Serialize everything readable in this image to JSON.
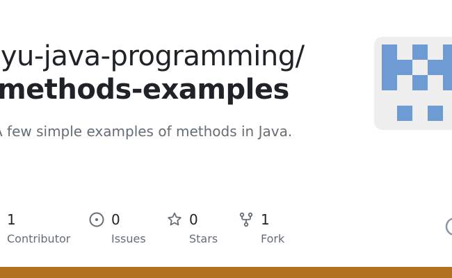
{
  "repo": {
    "owner_path": "nyu-java-programming/",
    "name": "methods-examples",
    "description": "A few simple examples of methods in Java."
  },
  "stats": [
    {
      "count": "1",
      "label": "Contributor",
      "icon": "people-icon"
    },
    {
      "count": "0",
      "label": "Issues",
      "icon": "issue-opened-icon"
    },
    {
      "count": "0",
      "label": "Stars",
      "icon": "star-icon"
    },
    {
      "count": "1",
      "label": "Fork",
      "icon": "repo-forked-icon"
    }
  ],
  "colors": {
    "avatar_bg": "#eeeeee",
    "avatar_fg": "#6e9bd4",
    "bottom_bar": "#b0701e",
    "muted_text": "#656d76",
    "icon": "#656d76"
  }
}
